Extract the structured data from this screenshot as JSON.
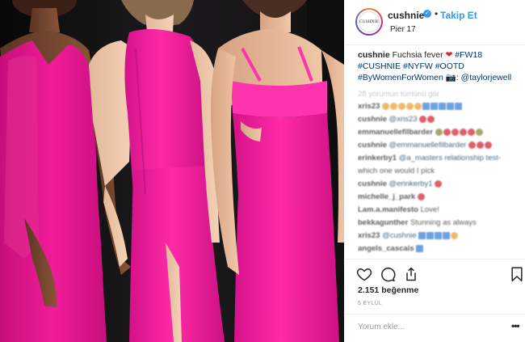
{
  "post": {
    "account": "cushnie",
    "avatar_text": "CUSHNIE",
    "verified_mark": "✓",
    "separator": "•",
    "follow_label": "Takip Et",
    "location": "Pier 17",
    "caption": {
      "user": "cushnie",
      "text": "Fuchsia fever",
      "emoji": "❤",
      "tags": [
        "#FW18",
        "#CUSHNIE",
        "#NYFW",
        "#OOTD",
        "#ByWomenForWomen"
      ],
      "camera": "📷:",
      "mention": "@taylorjewell"
    },
    "load_more": "28 yorumun tümünü gör",
    "comments": [
      {
        "user": "xris23",
        "text": ""
      },
      {
        "user": "cushnie",
        "text": "@xris23"
      },
      {
        "user": "emmanuellefilbarder",
        "text": ""
      },
      {
        "user": "cushnie",
        "text": "@emmanuellefilbarder"
      },
      {
        "user": "erinkerby1",
        "text": "@a_masters relationship test-"
      },
      {
        "user": "",
        "text": "which one would I pick"
      },
      {
        "user": "cushnie",
        "text": "@erinkerby1"
      },
      {
        "user": "michelle_j_park",
        "text": ""
      },
      {
        "user": "Lam.a.manifesto",
        "text": "Love!"
      },
      {
        "user": "bekkagunther",
        "text": "Stunning as always"
      },
      {
        "user": "xris23",
        "text": "@cushnie"
      },
      {
        "user": "angels_cascais",
        "text": ""
      }
    ],
    "likes": "2.151 beğenme",
    "date": "5 EYLÜL",
    "add_comment_placeholder": "Yorum ekle...",
    "more_label": "•••"
  },
  "icons": [
    "heart-icon",
    "comment-icon",
    "share-icon",
    "bookmark-icon",
    "verified-icon"
  ],
  "colors": {
    "accent": "#3897f0",
    "fuchsia": "#e5158f",
    "tag": "#003569"
  }
}
